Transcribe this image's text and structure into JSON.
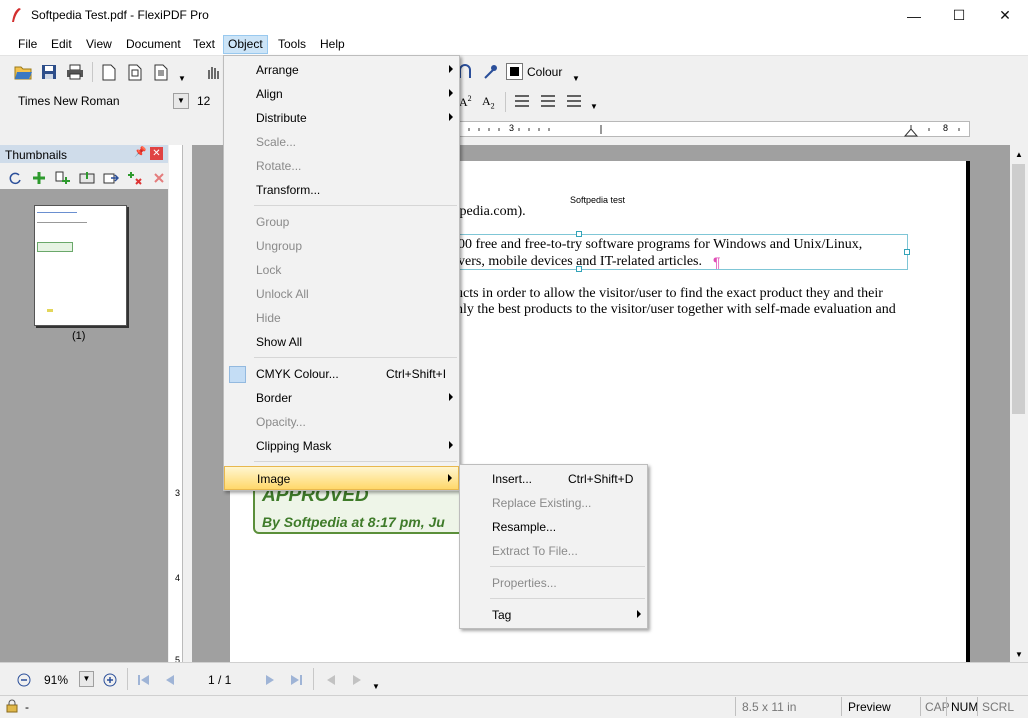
{
  "window": {
    "title": "Softpedia Test.pdf - FlexiPDF Pro"
  },
  "menubar": [
    "File",
    "Edit",
    "View",
    "Document",
    "Text",
    "Object",
    "Tools",
    "Help"
  ],
  "toolbar": {
    "font_name": "Times New Roman",
    "font_size": "12",
    "colour_label": "Colour"
  },
  "ruler_marks": [
    "3",
    "8"
  ],
  "thumbnails": {
    "title": "Thumbnails",
    "page_caption": "(1)"
  },
  "document": {
    "header": "Softpedia test",
    "line1": "ftpedia.com).",
    "line2": "00 free and free-to-try software programs for Windows and Unix/Linux,",
    "line3": "vers, mobile devices and IT-related articles.",
    "line4": "ucts in order to allow the visitor/user to find the exact product they and their",
    "line5": "nly the best products to the visitor/user together with self-made evaluation and",
    "stamp_title": "APPROVED",
    "stamp_sub": "By Softpedia at 8:17 pm, Ju"
  },
  "object_menu": {
    "arrange": "Arrange",
    "align": "Align",
    "distribute": "Distribute",
    "scale": "Scale...",
    "rotate": "Rotate...",
    "transform": "Transform...",
    "group": "Group",
    "ungroup": "Ungroup",
    "lock": "Lock",
    "unlock_all": "Unlock All",
    "hide": "Hide",
    "show_all": "Show All",
    "cmyk_colour": "CMYK Colour...",
    "cmyk_shortcut": "Ctrl+Shift+I",
    "border": "Border",
    "opacity": "Opacity...",
    "clipping_mask": "Clipping Mask",
    "image": "Image"
  },
  "image_menu": {
    "insert": "Insert...",
    "insert_shortcut": "Ctrl+Shift+D",
    "replace": "Replace Existing...",
    "resample": "Resample...",
    "extract": "Extract To File...",
    "properties": "Properties...",
    "tag": "Tag"
  },
  "navbar": {
    "zoom": "91%",
    "page": "1 / 1"
  },
  "statusbar": {
    "left": "-",
    "page_size": "8.5 x 11 in",
    "mode": "Preview",
    "cap": "CAP",
    "num": "NUM",
    "scrl": "SCRL"
  },
  "vertical_ruler_marks": [
    "3",
    "4",
    "5"
  ]
}
